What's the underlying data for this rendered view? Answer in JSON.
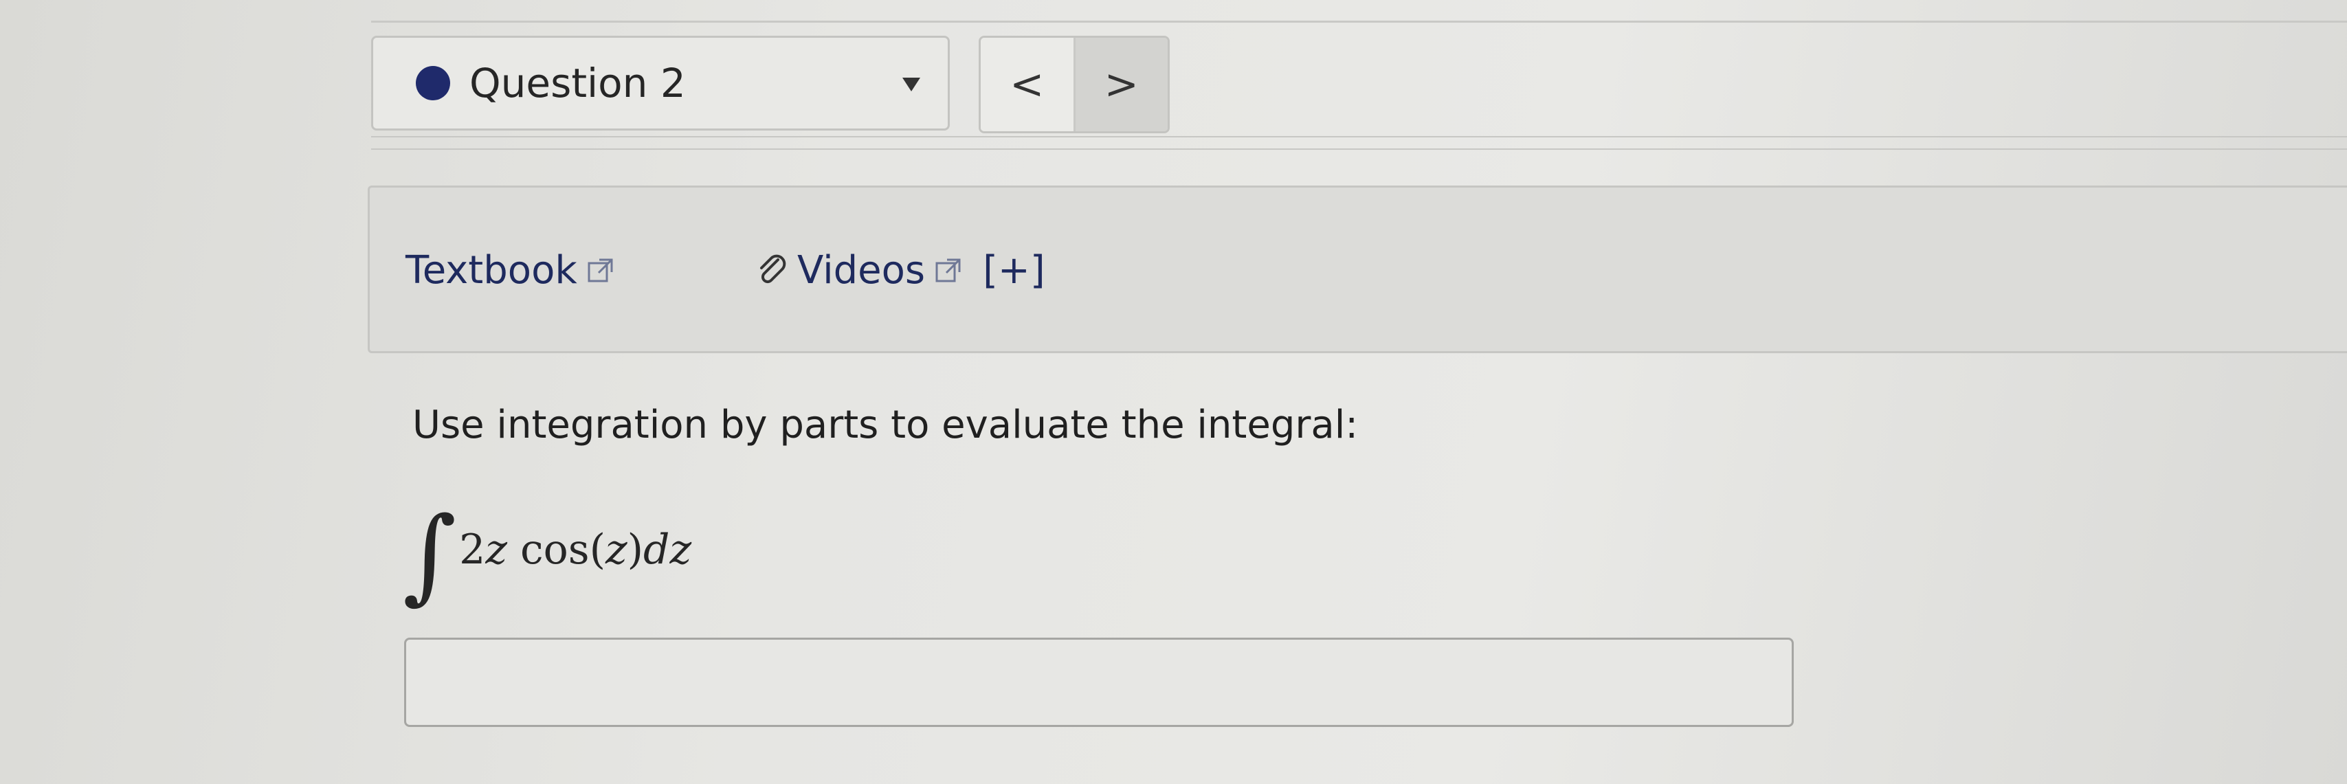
{
  "question": {
    "label": "Question 2",
    "status_color": "#1f2a6b"
  },
  "navigation": {
    "prev_label": "<",
    "next_label": ">"
  },
  "resources": {
    "textbook_label": "Textbook",
    "videos_label": "Videos",
    "expand_label": "[+]",
    "link_color": "#1e2a5e"
  },
  "problem": {
    "instruction": "Use integration by parts to evaluate the integral:",
    "integral_sign": "∫",
    "coefficient": "2",
    "variable": "z",
    "function": "cos",
    "differential": "dz"
  },
  "answer": {
    "value": ""
  }
}
